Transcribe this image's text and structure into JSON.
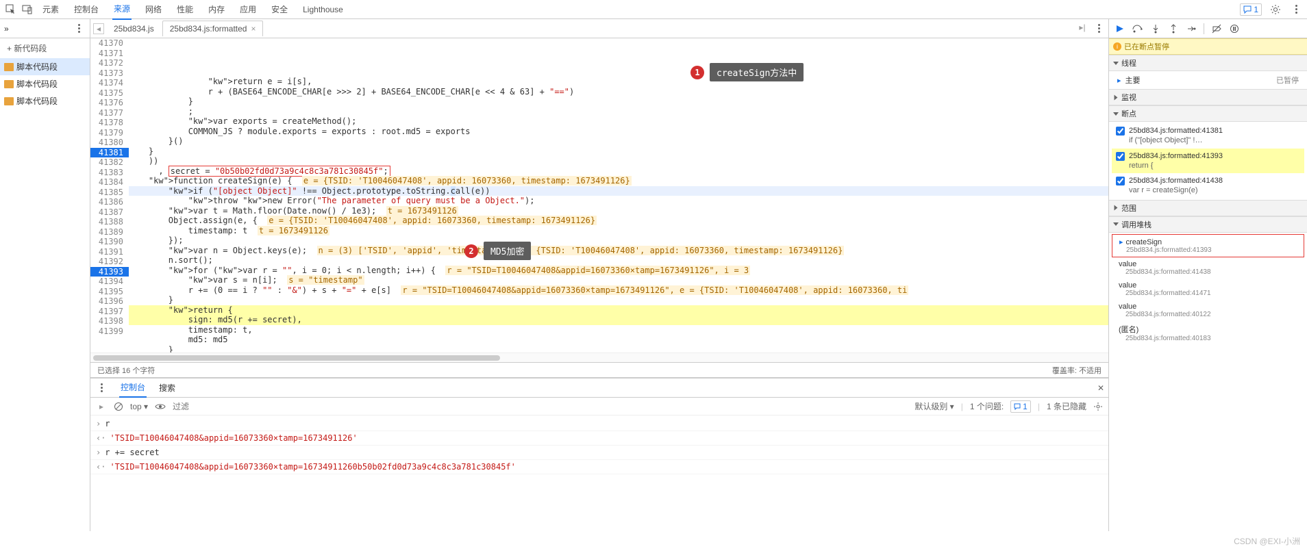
{
  "topbar": {
    "tabs": [
      "元素",
      "控制台",
      "来源",
      "网络",
      "性能",
      "内存",
      "应用",
      "安全",
      "Lighthouse"
    ],
    "activeTab": 2,
    "msgCount": "1"
  },
  "leftPane": {
    "newSnippet": "+ 新代码段",
    "files": [
      "脚本代码段",
      "脚本代码段",
      "脚本代码段"
    ]
  },
  "fileTabs": {
    "items": [
      "25bd834.js",
      "25bd834.js:formatted"
    ],
    "active": 1
  },
  "code": {
    "lines": [
      {
        "n": 41370,
        "t": "                return e = i[s],"
      },
      {
        "n": 41371,
        "t": "                r + (BASE64_ENCODE_CHAR[e >>> 2] + BASE64_ENCODE_CHAR[e << 4 & 63] + \"==\")"
      },
      {
        "n": 41372,
        "t": "            }"
      },
      {
        "n": 41373,
        "t": "            ;"
      },
      {
        "n": 41374,
        "t": "            var exports = createMethod();"
      },
      {
        "n": 41375,
        "t": "            COMMON_JS ? module.exports = exports : root.md5 = exports"
      },
      {
        "n": 41376,
        "t": "        }()"
      },
      {
        "n": 41377,
        "t": "    }"
      },
      {
        "n": 41378,
        "t": "    ))"
      },
      {
        "n": 41379,
        "t": "      , secret = \"0b50b02fd0d73a9c4c8c3a781c30845f\";",
        "redbox": [
          8,
          50
        ]
      },
      {
        "n": 41380,
        "t": "    function createSign(e) {  e = {TSID: 'T10046047408', appid: 16073360, timestamp: 1673491126}",
        "hint": true
      },
      {
        "n": 41381,
        "t": "        if (\"[object Object]\" !== Object.prototype.toString.call(e))",
        "bp": true,
        "exec": true,
        "dcall": true
      },
      {
        "n": 41382,
        "t": "            throw new Error(\"The parameter of query must be a Object.\");"
      },
      {
        "n": 41383,
        "t": "        var t = Math.floor(Date.now() / 1e3);  t = 1673491126",
        "hint": true
      },
      {
        "n": 41384,
        "t": "        Object.assign(e, {  e = {TSID: 'T10046047408', appid: 16073360, timestamp: 1673491126}",
        "hint": true
      },
      {
        "n": 41385,
        "t": "            timestamp: t  t = 1673491126",
        "hint": true
      },
      {
        "n": 41386,
        "t": "        });"
      },
      {
        "n": 41387,
        "t": "        var n = Object.keys(e);  n = (3) ['TSID', 'appid', 'timestamp'], e = {TSID: 'T10046047408', appid: 16073360, timestamp: 1673491126}",
        "hint": true
      },
      {
        "n": 41388,
        "t": "        n.sort();"
      },
      {
        "n": 41389,
        "t": "        for (var r = \"\", i = 0; i < n.length; i++) {  r = \"TSID=T10046047408&appid=16073360&timestamp=1673491126\", i = 3",
        "hint": true
      },
      {
        "n": 41390,
        "t": "            var s = n[i];  s = \"timestamp\"",
        "hint": true
      },
      {
        "n": 41391,
        "t": "            r += (0 == i ? \"\" : \"&\") + s + \"=\" + e[s]  r = \"TSID=T10046047408&appid=16073360&timestamp=1673491126\", e = {TSID: 'T10046047408', appid: 16073360, ti",
        "hint": true
      },
      {
        "n": 41392,
        "t": "        }"
      },
      {
        "n": 41393,
        "t": "        return {",
        "bp": true,
        "hl": true
      },
      {
        "n": 41394,
        "t": "            sign: md5(r += secret),",
        "hl": true
      },
      {
        "n": 41395,
        "t": "            timestamp: t,"
      },
      {
        "n": 41396,
        "t": "            md5: md5"
      },
      {
        "n": 41397,
        "t": "        }"
      },
      {
        "n": 41398,
        "t": "    }"
      },
      {
        "n": 41399,
        "t": ""
      }
    ]
  },
  "selbar": {
    "left": "已选择 16 个字符",
    "right": "覆盖率: 不适用"
  },
  "right": {
    "pausedMsg": "已在断点暂停",
    "sections": {
      "threads": "线程",
      "main": "主要",
      "paused": "已暂停",
      "watch": "监视",
      "breakpoints": "断点",
      "scope": "范围",
      "callstack": "调用堆栈"
    },
    "bps": [
      {
        "name": "25bd834.js:formatted:41381",
        "code": "if (\"[object Object]\" !…"
      },
      {
        "name": "25bd834.js:formatted:41393",
        "code": "return {",
        "cur": true
      },
      {
        "name": "25bd834.js:formatted:41438",
        "code": "var r = createSign(e)"
      }
    ],
    "stack": [
      {
        "fn": "createSign",
        "loc": "25bd834.js:formatted:41393",
        "top": true
      },
      {
        "fn": "value",
        "loc": "25bd834.js:formatted:41438"
      },
      {
        "fn": "value",
        "loc": "25bd834.js:formatted:41471"
      },
      {
        "fn": "value",
        "loc": "25bd834.js:formatted:40122"
      },
      {
        "fn": "(匿名)",
        "loc": "25bd834.js:formatted:40183"
      }
    ]
  },
  "console": {
    "tabs": [
      "控制台",
      "搜索"
    ],
    "filterPlaceholder": "过滤",
    "top": "top ▾",
    "level": "默认级别 ▾",
    "issues": "1 个问题:",
    "issueCount": "1",
    "hidden": "1 条已隐藏",
    "lines": [
      {
        "p": ">",
        "t": "r"
      },
      {
        "p": "<",
        "t": "'TSID=T10046047408&appid=16073360&timestamp=1673491126'",
        "red": true
      },
      {
        "p": ">",
        "t": "r += secret"
      },
      {
        "p": "<",
        "t": "'TSID=T10046047408&appid=16073360&timestamp=16734911260b50b02fd0d73a9c4c8c3a781c30845f'",
        "red": true
      }
    ]
  },
  "annotations": {
    "a1": "createSign方法中",
    "a2": "MD5加密"
  },
  "watermark": "CSDN @EXI-小洲"
}
